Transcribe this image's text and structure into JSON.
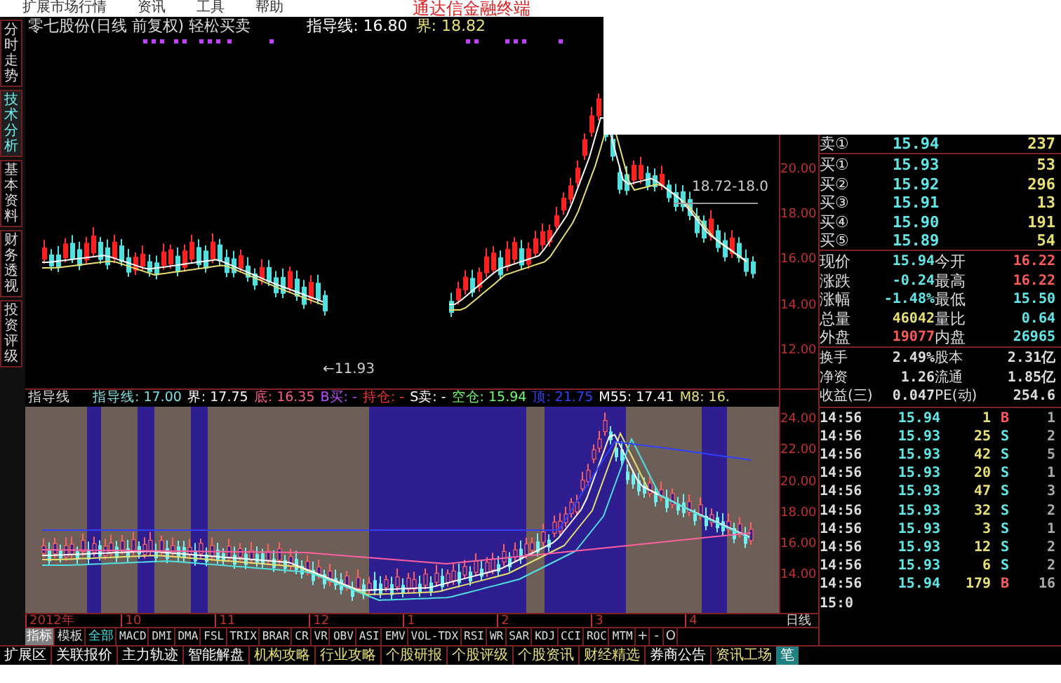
{
  "menu": {
    "items": [
      "扩展市场行情",
      "资讯",
      "工具",
      "帮助"
    ],
    "title": "通达信金融终端"
  },
  "side_tabs": [
    {
      "label": "分时走势",
      "selected": false
    },
    {
      "label": "技术分析",
      "selected": true
    },
    {
      "label": "基本资料",
      "selected": false
    },
    {
      "label": "财务透视",
      "selected": false
    },
    {
      "label": "投资评级",
      "selected": false
    }
  ],
  "upper_chart": {
    "title": "零七股份(日线 前复权) 轻松买卖",
    "readouts": [
      {
        "label": "指导线: 16.80",
        "color": "#ffffff"
      },
      {
        "label": "界: 18.82",
        "color": "#e8e070"
      }
    ],
    "annotations": [
      {
        "kind": "high",
        "text": "18.72-18.0"
      },
      {
        "kind": "low",
        "text": "←11.93"
      }
    ],
    "axis_labels": [
      "20.00",
      "18.00",
      "16.00",
      "14.00",
      "12.00"
    ]
  },
  "lower_chart": {
    "name": "指导线",
    "readouts": [
      {
        "kind": "guide",
        "label": "指导线: 17.00"
      },
      {
        "kind": "bound",
        "label": "界: 17.75"
      },
      {
        "kind": "floor",
        "label": "底: 16.35"
      },
      {
        "kind": "buy",
        "label": "B买: -"
      },
      {
        "kind": "hold",
        "label": "持仓: -"
      },
      {
        "kind": "sell",
        "label": "S卖: -"
      },
      {
        "kind": "flat",
        "label": "空仓: 15.94"
      },
      {
        "kind": "top",
        "label": "顶: 21.75"
      },
      {
        "kind": "ma_long",
        "label": "M55: 17.41"
      },
      {
        "kind": "ma_short",
        "label": "M8: 16."
      }
    ],
    "axis_labels": [
      "24.00",
      "22.00",
      "20.00",
      "18.00",
      "16.00",
      "14.00"
    ]
  },
  "date_axis": [
    "2012年",
    "10",
    "11",
    "12",
    "1",
    "2",
    "3",
    "4"
  ],
  "period_label": "日线",
  "indicator_tabs": [
    {
      "kind": "mode",
      "label": "指标",
      "selected": true
    },
    {
      "kind": "mode",
      "label": "模板",
      "selected": false
    },
    {
      "kind": "filter",
      "label": "全部",
      "selected": true
    },
    {
      "kind": "indicator",
      "label": "MACD",
      "selected": false
    },
    {
      "kind": "indicator",
      "label": "DMI",
      "selected": false
    },
    {
      "kind": "indicator",
      "label": "DMA",
      "selected": false
    },
    {
      "kind": "indicator",
      "label": "FSL",
      "selected": false
    },
    {
      "kind": "indicator",
      "label": "TRIX",
      "selected": false
    },
    {
      "kind": "indicator",
      "label": "BRAR",
      "selected": false
    },
    {
      "kind": "indicator",
      "label": "CR",
      "selected": false
    },
    {
      "kind": "indicator",
      "label": "VR",
      "selected": false
    },
    {
      "kind": "indicator",
      "label": "OBV",
      "selected": false
    },
    {
      "kind": "indicator",
      "label": "ASI",
      "selected": false
    },
    {
      "kind": "indicator",
      "label": "EMV",
      "selected": false
    },
    {
      "kind": "indicator",
      "label": "VOL-TDX",
      "selected": false
    },
    {
      "kind": "indicator",
      "label": "RSI",
      "selected": false
    },
    {
      "kind": "indicator",
      "label": "WR",
      "selected": false
    },
    {
      "kind": "indicator",
      "label": "SAR",
      "selected": false
    },
    {
      "kind": "indicator",
      "label": "KDJ",
      "selected": false
    },
    {
      "kind": "indicator",
      "label": "CCI",
      "selected": false
    },
    {
      "kind": "indicator",
      "label": "ROC",
      "selected": false
    },
    {
      "kind": "indicator",
      "label": "MTM",
      "selected": false
    }
  ],
  "zoom_buttons": [
    "+",
    "-",
    "O"
  ],
  "quote": {
    "ask": {
      "label": "卖①",
      "price": "15.94",
      "volume": "237"
    },
    "bids": [
      {
        "label": "买①",
        "price": "15.93",
        "volume": "53"
      },
      {
        "label": "买②",
        "price": "15.92",
        "volume": "296"
      },
      {
        "label": "买③",
        "price": "15.91",
        "volume": "13"
      },
      {
        "label": "买④",
        "price": "15.90",
        "volume": "191"
      },
      {
        "label": "买⑤",
        "price": "15.89",
        "volume": "54"
      }
    ],
    "stats": [
      [
        {
          "label": "现价",
          "value": "15.94",
          "color": "#60e8e8"
        },
        {
          "label": "今开",
          "value": "16.22",
          "color": "#ff5a5a"
        }
      ],
      [
        {
          "label": "涨跌",
          "value": "-0.24",
          "color": "#60e8e8"
        },
        {
          "label": "最高",
          "value": "16.22",
          "color": "#ff5a5a"
        }
      ],
      [
        {
          "label": "涨幅",
          "value": "-1.48%",
          "color": "#60e8e8"
        },
        {
          "label": "最低",
          "value": "15.50",
          "color": "#60e8e8"
        }
      ],
      [
        {
          "label": "总量",
          "value": "46042",
          "color": "#e8e070"
        },
        {
          "label": "量比",
          "value": "0.64",
          "color": "#60e8e8"
        }
      ],
      [
        {
          "label": "外盘",
          "value": "19077",
          "color": "#ff5a5a"
        },
        {
          "label": "内盘",
          "value": "26965",
          "color": "#60e8e8"
        }
      ]
    ],
    "fundamentals": [
      [
        {
          "label": "换手",
          "value": "2.49%"
        },
        {
          "label": "股本",
          "value": "2.31亿"
        }
      ],
      [
        {
          "label": "净资",
          "value": "1.26"
        },
        {
          "label": "流通",
          "value": "1.85亿"
        }
      ],
      [
        {
          "label": "收益(三)",
          "value": "0.047"
        },
        {
          "label": "PE(动)",
          "value": "254.6"
        }
      ]
    ]
  },
  "ticks": [
    {
      "time": "14:56",
      "price": "15.94",
      "volume": "1",
      "side": "B",
      "color": "#ff5a5a",
      "count": "1"
    },
    {
      "time": "14:56",
      "price": "15.93",
      "volume": "25",
      "side": "S",
      "color": "#60e8e8",
      "count": "2"
    },
    {
      "time": "14:56",
      "price": "15.93",
      "volume": "42",
      "side": "S",
      "color": "#60e8e8",
      "count": "5"
    },
    {
      "time": "14:56",
      "price": "15.93",
      "volume": "20",
      "side": "S",
      "color": "#60e8e8",
      "count": "1"
    },
    {
      "time": "14:56",
      "price": "15.93",
      "volume": "47",
      "side": "S",
      "color": "#60e8e8",
      "count": "3"
    },
    {
      "time": "14:56",
      "price": "15.93",
      "volume": "32",
      "side": "S",
      "color": "#60e8e8",
      "count": "2"
    },
    {
      "time": "14:56",
      "price": "15.93",
      "volume": "3",
      "side": "S",
      "color": "#60e8e8",
      "count": "1"
    },
    {
      "time": "14:56",
      "price": "15.93",
      "volume": "12",
      "side": "S",
      "color": "#60e8e8",
      "count": "2"
    },
    {
      "time": "14:56",
      "price": "15.93",
      "volume": "6",
      "side": "S",
      "color": "#60e8e8",
      "count": "2"
    },
    {
      "time": "14:56",
      "price": "15.94",
      "volume": "179",
      "side": "B",
      "color": "#ff5a5a",
      "count": "16"
    },
    {
      "time": "15:0"
    }
  ],
  "bottom_tabs": [
    {
      "label": "扩展区",
      "highlighted": false
    },
    {
      "label": "关联报价",
      "highlighted": false
    },
    {
      "label": "主力轨迹",
      "highlighted": false
    },
    {
      "label": "智能解盘",
      "highlighted": false
    },
    {
      "label": "机构攻略",
      "highlighted": true
    },
    {
      "label": "行业攻略",
      "highlighted": true
    },
    {
      "label": "个股研报",
      "highlighted": true
    },
    {
      "label": "个股评级",
      "highlighted": true
    },
    {
      "label": "个股资讯",
      "highlighted": true
    },
    {
      "label": "财经精选",
      "highlighted": true
    },
    {
      "label": "券商公告",
      "highlighted": false
    }
  ],
  "bottom_right_tabs": [
    {
      "label": "资讯工场",
      "selected": false
    },
    {
      "label": "笔",
      "selected": true
    }
  ]
}
